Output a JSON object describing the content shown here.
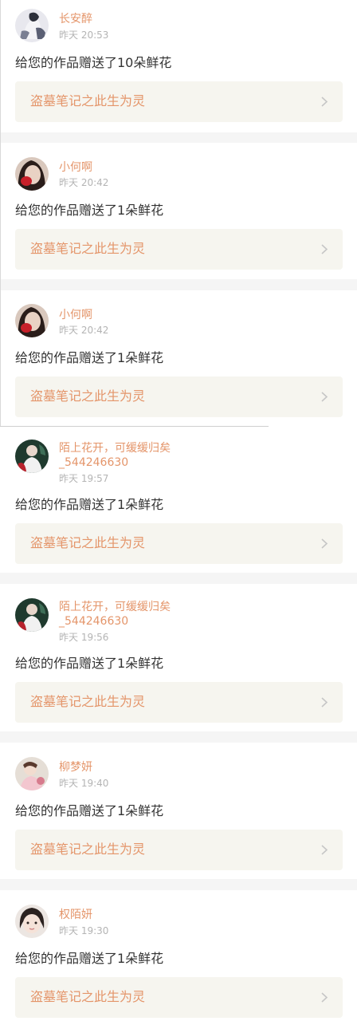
{
  "colors": {
    "username": "#e4956a",
    "timestamp": "#b4b4b4",
    "message": "#333333",
    "work_link_bg": "#f6f5ef",
    "work_link_text": "#e4956a",
    "chevron": "#c6c6c6",
    "page_bg": "#f5f5f5"
  },
  "notifications": [
    {
      "username": "长安醉",
      "username_line2": "",
      "time": "昨天 20:53",
      "message": "给您的作品赠送了10朵鲜花",
      "work_title": "盗墓笔记之此生为灵",
      "avatar": "avatar-photo-white-figure",
      "chevron_icon": "chevron-right-icon"
    },
    {
      "username": "小何啊",
      "username_line2": "",
      "time": "昨天 20:42",
      "message": "给您的作品赠送了1朵鲜花",
      "work_title": "盗墓笔记之此生为灵",
      "avatar": "avatar-photo-red-lips",
      "chevron_icon": "chevron-right-icon"
    },
    {
      "username": "小何啊",
      "username_line2": "",
      "time": "昨天 20:42",
      "message": "给您的作品赠送了1朵鲜花",
      "work_title": "盗墓笔记之此生为灵",
      "avatar": "avatar-photo-red-lips",
      "chevron_icon": "chevron-right-icon"
    },
    {
      "username": "陌上花开，可缓缓归矣",
      "username_line2": "_544246630",
      "time": "昨天 19:57",
      "message": "给您的作品赠送了1朵鲜花",
      "work_title": "盗墓笔记之此生为灵",
      "avatar": "avatar-photo-green-figure",
      "chevron_icon": "chevron-right-icon"
    },
    {
      "username": "陌上花开，可缓缓归矣",
      "username_line2": "_544246630",
      "time": "昨天 19:56",
      "message": "给您的作品赠送了1朵鲜花",
      "work_title": "盗墓笔记之此生为灵",
      "avatar": "avatar-photo-green-figure",
      "chevron_icon": "chevron-right-icon"
    },
    {
      "username": "柳梦妍",
      "username_line2": "",
      "time": "昨天 19:40",
      "message": "给您的作品赠送了1朵鲜花",
      "work_title": "盗墓笔记之此生为灵",
      "avatar": "avatar-photo-pink-figure",
      "chevron_icon": "chevron-right-icon"
    },
    {
      "username": "权陌妍",
      "username_line2": "",
      "time": "昨天 19:30",
      "message": "给您的作品赠送了1朵鲜花",
      "work_title": "盗墓笔记之此生为灵",
      "avatar": "avatar-photo-child-face",
      "chevron_icon": "chevron-right-icon"
    }
  ]
}
